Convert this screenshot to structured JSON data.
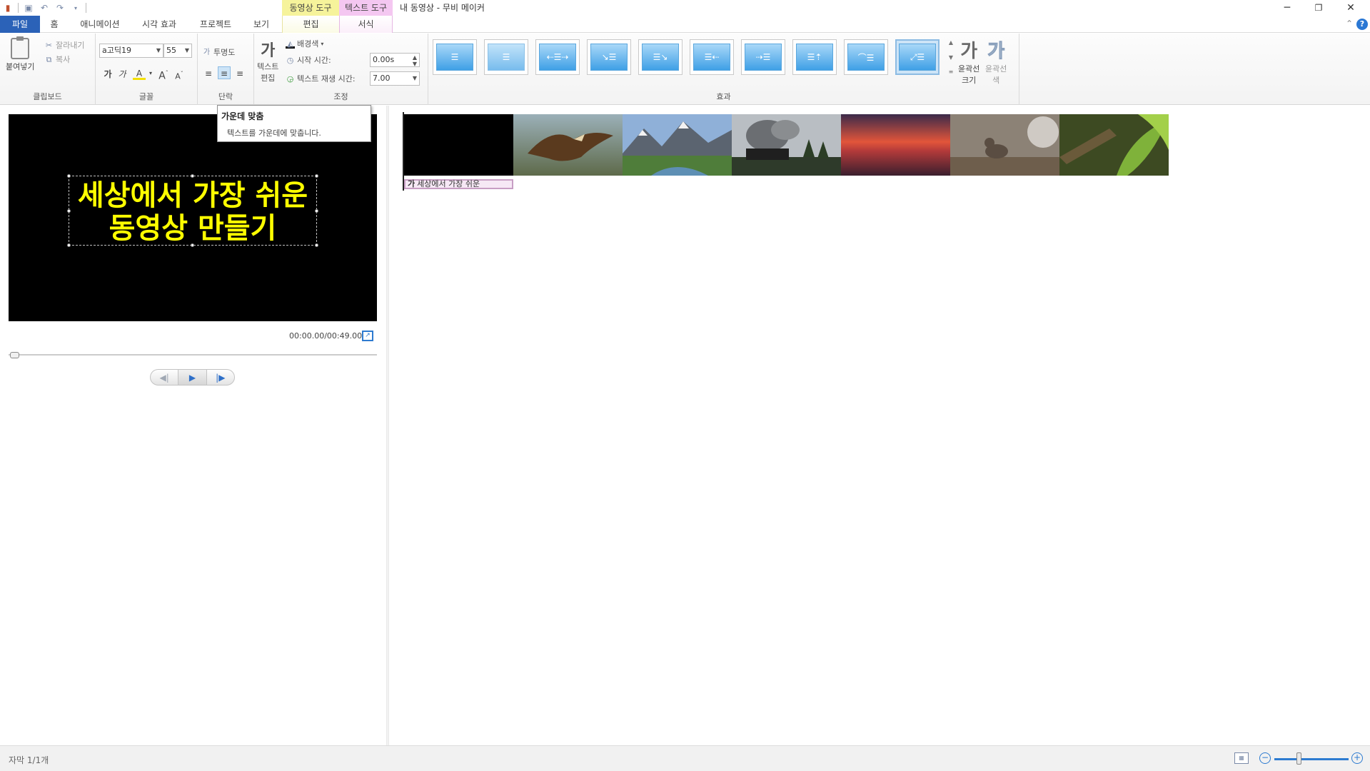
{
  "window": {
    "title": "내 동영상 - 무비 메이커",
    "context_video": "동영상 도구",
    "context_text": "텍스트 도구"
  },
  "tabs": {
    "file": "파일",
    "home": "홈",
    "animation": "애니메이션",
    "visual_effects": "시각 효과",
    "project": "프로젝트",
    "view": "보기",
    "edit": "편집",
    "format": "서식"
  },
  "ribbon": {
    "clipboard": {
      "label": "클립보드",
      "paste": "붙여넣기",
      "cut": "잘라내기",
      "copy": "복사"
    },
    "font": {
      "label": "글꼴",
      "family": "a고딕19",
      "size": "55"
    },
    "paragraph": {
      "label": "단락",
      "transparency": "투명도"
    },
    "adjust": {
      "label": "조정",
      "edit_text_line1": "텍스트",
      "edit_text_line2": "편집",
      "background_color": "배경색",
      "start_time_label": "시작 시간:",
      "start_time_value": "0.00s",
      "duration_label": "텍스트 재생 시간:",
      "duration_value": "7.00"
    },
    "effects": {
      "label": "효과",
      "outline_size_line1": "윤곽선",
      "outline_size_line2": "크기",
      "outline_color_line1": "윤곽선",
      "outline_color_line2": "색",
      "glyph": "가"
    }
  },
  "tooltip": {
    "title": "가운데 맞춤",
    "description": "텍스트를 가운데에 맞춥니다."
  },
  "preview": {
    "caption_line1": "세상에서 가장 쉬운",
    "caption_line2": "동영상 만들기",
    "timecode": "00:00.00/00:49.00"
  },
  "storyboard": {
    "caption_glyph": "가",
    "caption_text": "세상에서 가장 쉬운",
    "frames": [
      "black",
      "eagle",
      "mountain-lake",
      "steam-train",
      "sunset-sea",
      "squirrel",
      "green-leaves"
    ]
  },
  "status": {
    "caption_count": "자막 1/1개"
  },
  "colors": {
    "file_tab": "#2b62b8",
    "caption_text": "#ffff00",
    "context_video": "#f6f39b",
    "context_text": "#f4c7f1"
  }
}
